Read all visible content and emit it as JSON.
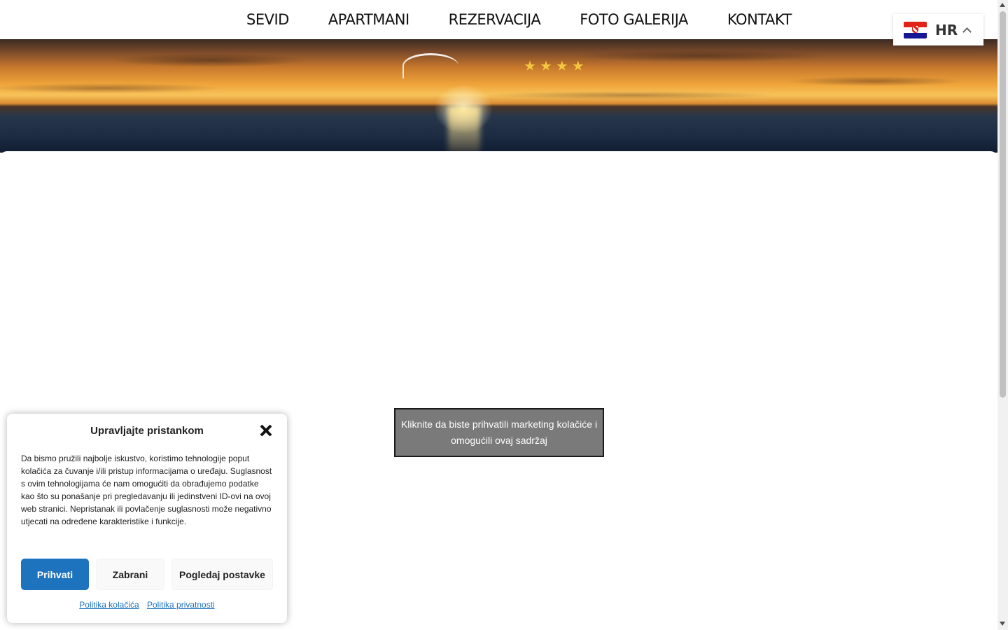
{
  "nav": {
    "items": [
      {
        "label": "SEVID"
      },
      {
        "label": "APARTMANI"
      },
      {
        "label": "REZERVACIJA"
      },
      {
        "label": "FOTO GALERIJA"
      },
      {
        "label": "KONTAKT"
      }
    ]
  },
  "language": {
    "code": "HR",
    "flag_icon": "croatia-flag-icon"
  },
  "hero": {
    "stars": [
      "★",
      "★",
      "★",
      "★"
    ],
    "star_count": 4
  },
  "content": {
    "placeholder_text": "Kliknite da biste prihvatili marketing kolačiće i omogućili ovaj sadržaj"
  },
  "cookie_banner": {
    "title": "Upravljajte pristankom",
    "body": "Da bismo pružili najbolje iskustvo, koristimo tehnologije poput kolačića za čuvanje i/ili pristup informacijama o uređaju. Suglasnost s ovim tehnologijama će nam omogućiti da obrađujemo podatke kao što su ponašanje pri pregledavanju ili jedinstveni ID-ovi na ovoj web stranici. Nepristanak ili povlačenje suglasnosti može negativno utjecati na određene karakteristike i funkcije.",
    "accept_label": "Prihvati",
    "deny_label": "Zabrani",
    "preferences_label": "Pogledaj postavke",
    "cookie_policy_link": "Politika kolačića",
    "privacy_policy_link": "Politika privatnosti"
  },
  "colors": {
    "accent": "#1e73be",
    "placeholder_bg": "#7a7a7a"
  }
}
